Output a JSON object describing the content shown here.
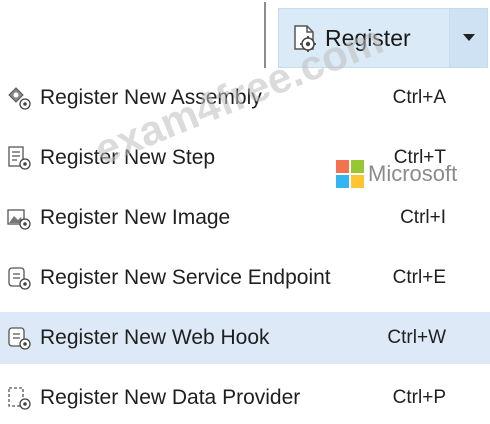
{
  "toolbar": {
    "register_label": "Register",
    "register_icon": "register-plugin-icon",
    "dropdown_icon": "caret-down-icon"
  },
  "menu": {
    "items": [
      {
        "label": "Register New Assembly",
        "shortcut": "Ctrl+A",
        "icon": "assembly-icon",
        "highlighted": false
      },
      {
        "label": "Register New Step",
        "shortcut": "Ctrl+T",
        "icon": "step-icon",
        "highlighted": false
      },
      {
        "label": "Register New Image",
        "shortcut": "Ctrl+I",
        "icon": "image-icon",
        "highlighted": false
      },
      {
        "label": "Register New Service Endpoint",
        "shortcut": "Ctrl+E",
        "icon": "service-endpoint-icon",
        "highlighted": false
      },
      {
        "label": "Register New Web Hook",
        "shortcut": "Ctrl+W",
        "icon": "web-hook-icon",
        "highlighted": true
      },
      {
        "label": "Register New Data Provider",
        "shortcut": "Ctrl+P",
        "icon": "data-provider-icon",
        "highlighted": false
      }
    ]
  },
  "watermark": {
    "text": "exam4free.com",
    "logo_text": "Microsoft"
  },
  "colors": {
    "highlight": "#dde9f6",
    "button_bg": "#dbeaf7",
    "ms_red": "#f25022",
    "ms_green": "#7fba00",
    "ms_blue": "#00a4ef",
    "ms_yellow": "#ffb900"
  }
}
